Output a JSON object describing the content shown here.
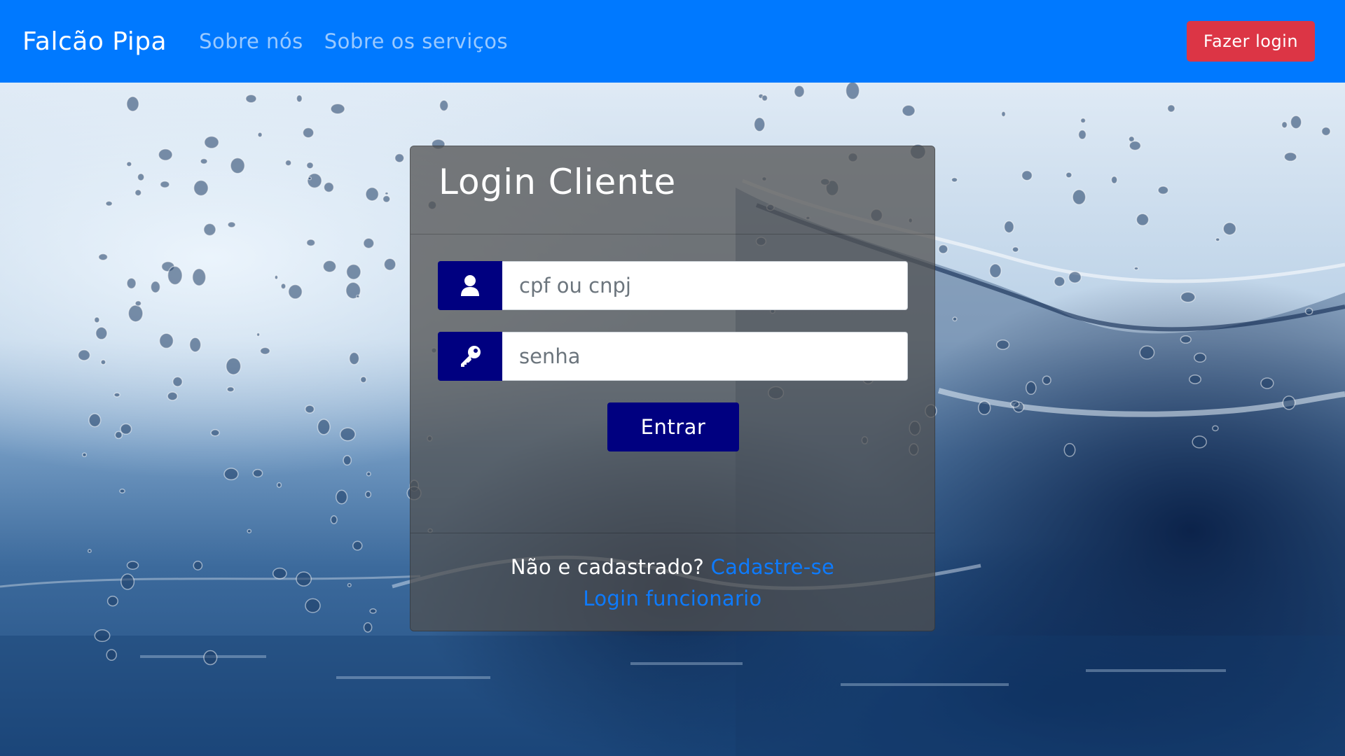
{
  "navbar": {
    "brand": "Falcão Pipa",
    "links": [
      "Sobre nós",
      "Sobre os serviços"
    ],
    "login_button": "Fazer login",
    "color": "#0079ff",
    "login_button_color": "#dc3545"
  },
  "login_card": {
    "title": "Login Cliente",
    "username_placeholder": "cpf ou cnpj",
    "password_placeholder": "senha",
    "username_icon": "user-icon",
    "password_icon": "key-icon",
    "submit_label": "Entrar",
    "accent_color": "#000080",
    "footer": {
      "question": "Não e cadastrado?",
      "signup_link": "Cadastre-se",
      "employee_login_link": "Login funcionario",
      "link_color": "#0d7bff"
    }
  },
  "background": {
    "description_icon": "water-splash-image"
  }
}
